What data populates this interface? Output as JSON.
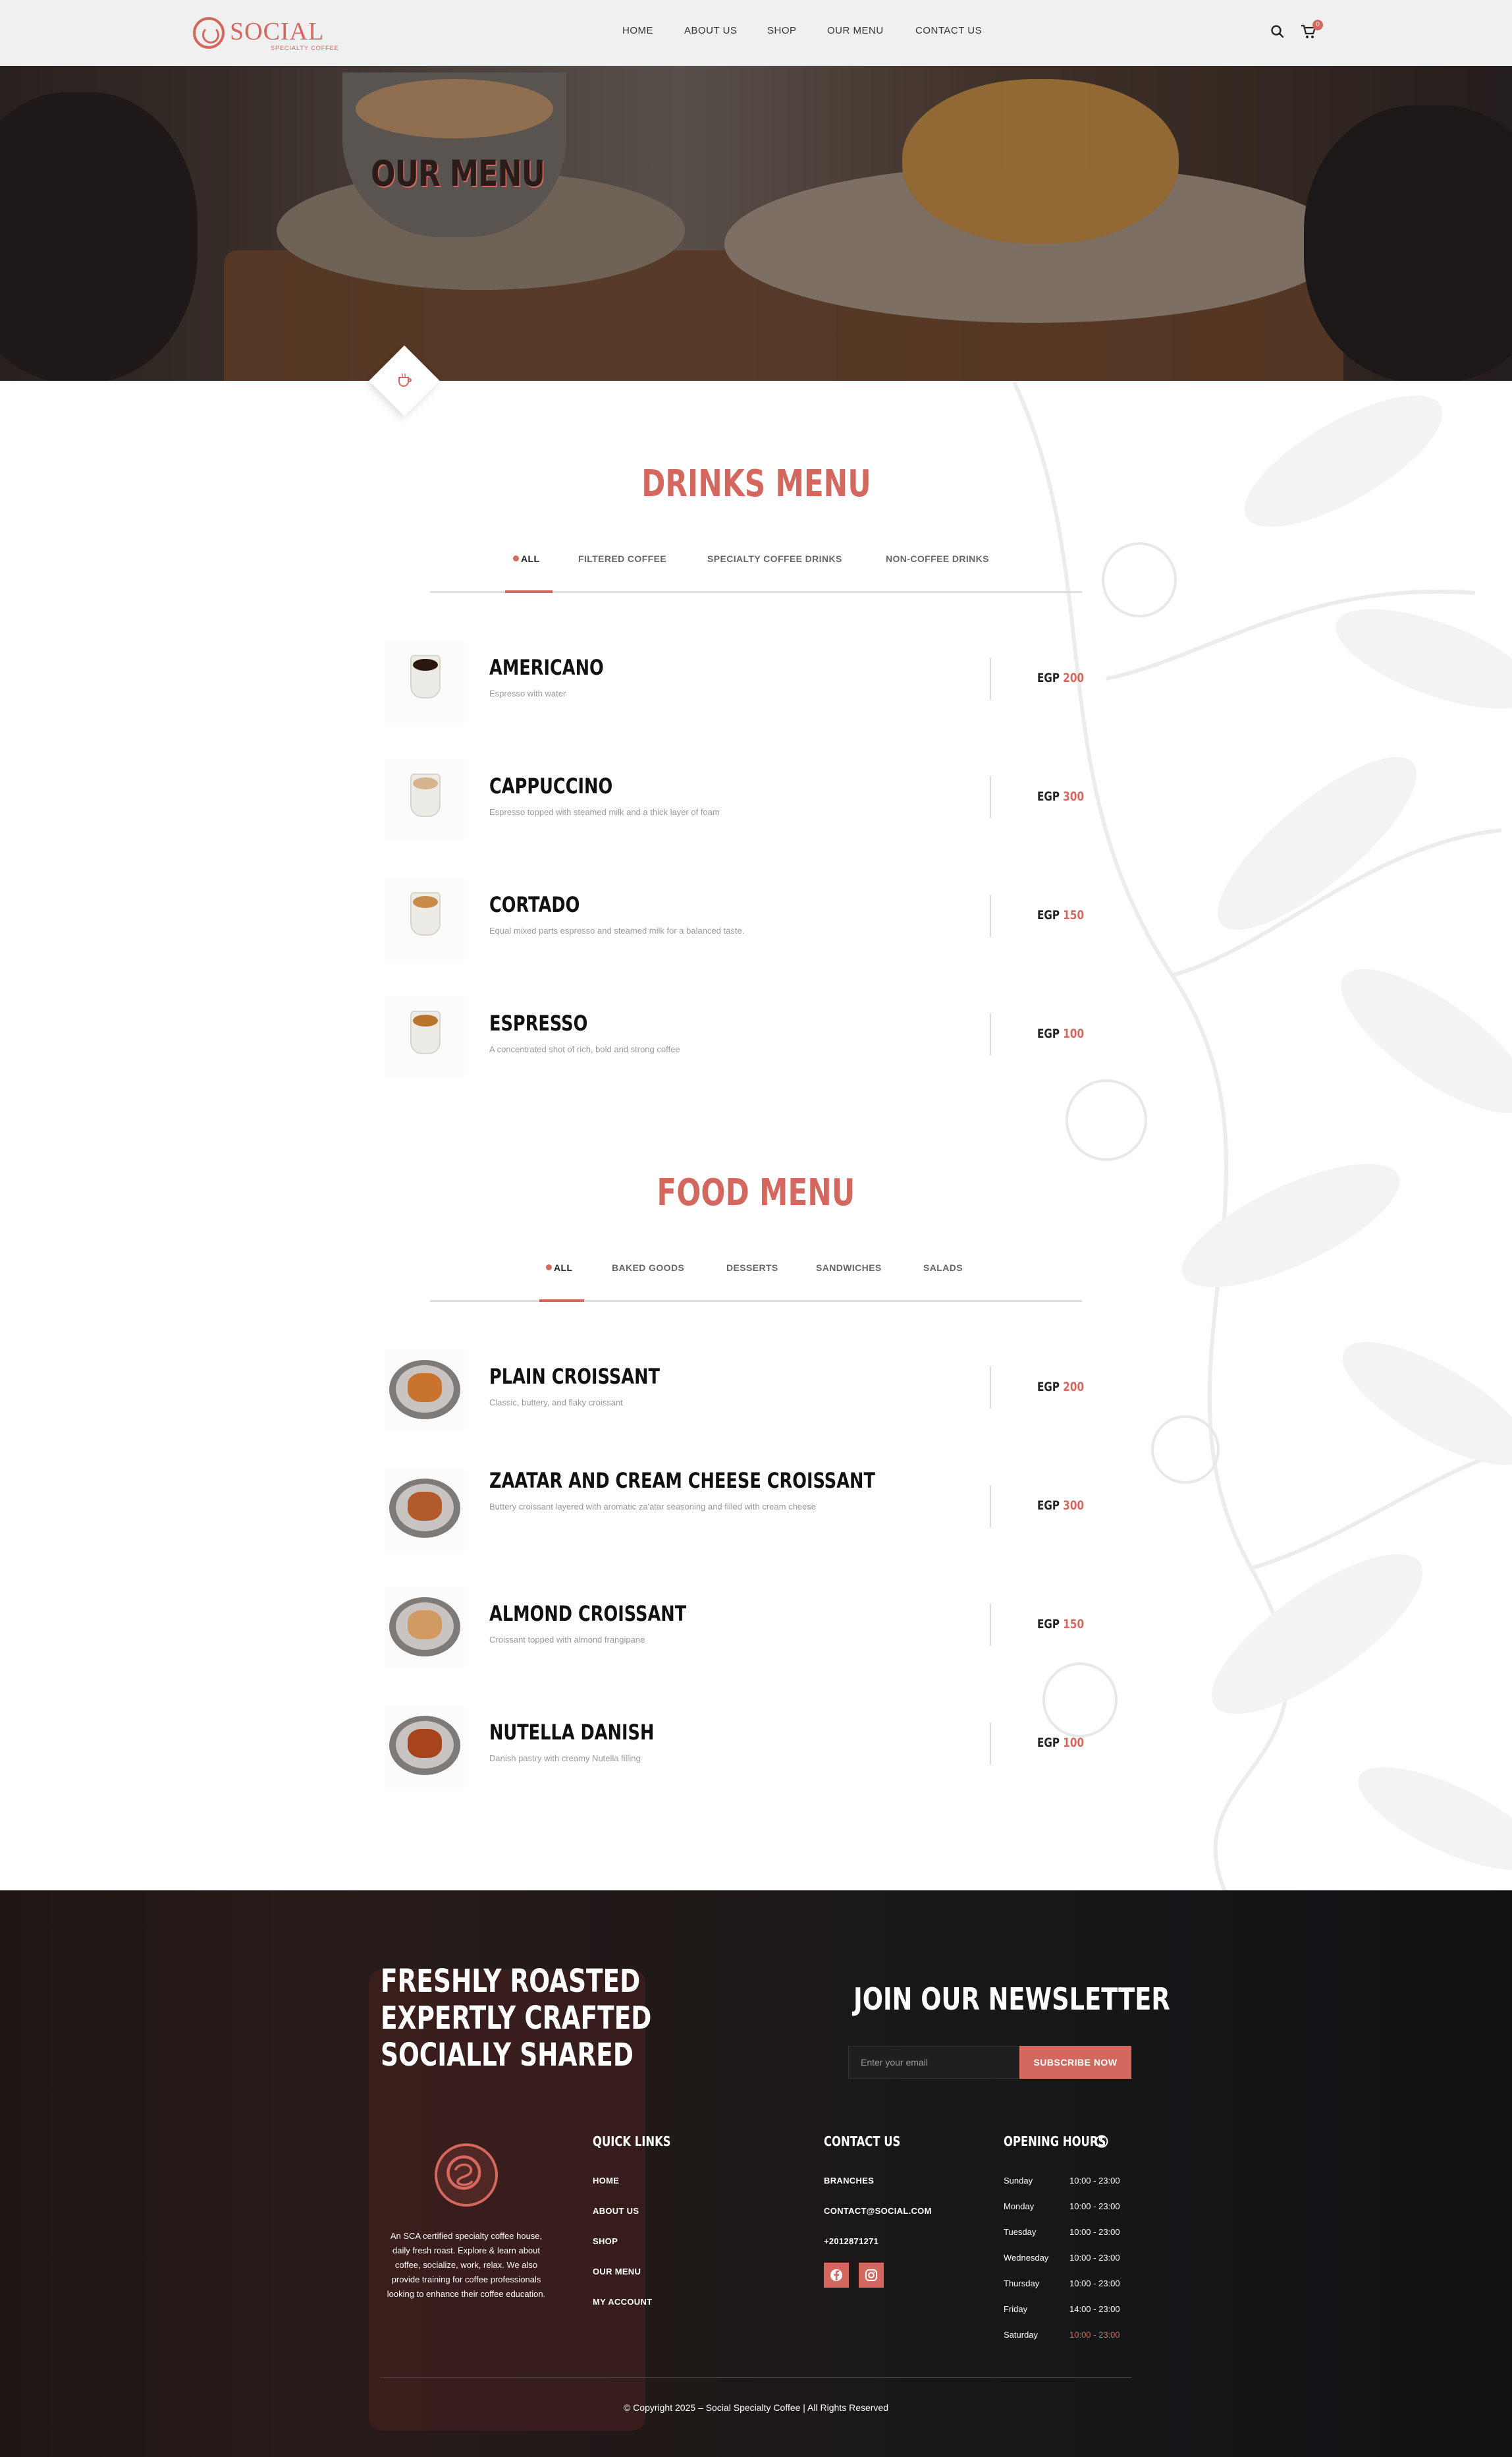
{
  "brand": {
    "name": "SOCIAL",
    "tagline": "SPECIALTY COFFEE",
    "accent_color": "#d5685e"
  },
  "nav": {
    "items": [
      "HOME",
      "ABOUT US",
      "SHOP",
      "OUR MENU",
      "CONTACT US"
    ],
    "search_icon": "search-icon",
    "cart_icon": "cart-icon",
    "cart_count": "0"
  },
  "hero": {
    "title": "OUR MENU"
  },
  "drinks": {
    "title": "DRINKS MENU",
    "tabs": [
      "ALL",
      "FILTERED COFFEE",
      "SPECIALTY COFFEE DRINKS",
      "NON-COFFEE DRINKS"
    ],
    "active_tab": "ALL",
    "items": [
      {
        "name": "AMERICANO",
        "desc": "Espresso with water",
        "currency": "EGP",
        "price": "200"
      },
      {
        "name": "CAPPUCCINO",
        "desc": "Espresso topped with steamed milk and a thick layer of foam",
        "currency": "EGP",
        "price": "300"
      },
      {
        "name": "CORTADO",
        "desc": "Equal mixed parts espresso and steamed milk for a balanced taste.",
        "currency": "EGP",
        "price": "150"
      },
      {
        "name": "ESPRESSO",
        "desc": "A concentrated shot of rich, bold and strong coffee",
        "currency": "EGP",
        "price": "100"
      }
    ]
  },
  "food": {
    "title": "FOOD MENU",
    "tabs": [
      "ALL",
      "BAKED GOODS",
      "DESSERTS",
      "SANDWICHES",
      "SALADS"
    ],
    "active_tab": "ALL",
    "items": [
      {
        "name": "PLAIN CROISSANT",
        "desc": "Classic, buttery, and flaky croissant",
        "currency": "EGP",
        "price": "200"
      },
      {
        "name": "ZAATAR AND CREAM CHEESE CROISSANT",
        "desc": "Buttery croissant layered with aromatic za'atar seasoning and filled with cream cheese",
        "currency": "EGP",
        "price": "300"
      },
      {
        "name": "ALMOND CROISSANT",
        "desc": "Croissant topped with almond frangipane",
        "currency": "EGP",
        "price": "150"
      },
      {
        "name": "NUTELLA DANISH",
        "desc": "Danish pastry with creamy Nutella filling",
        "currency": "EGP",
        "price": "100"
      }
    ]
  },
  "footer": {
    "tagline": [
      "FRESHLY ROASTED",
      "EXPERTLY CRAFTED",
      "SOCIALLY SHARED"
    ],
    "newsletter": {
      "title": "JOIN OUR NEWSLETTER",
      "placeholder": "Enter your email",
      "button": "SUBSCRIBE NOW"
    },
    "about": "An SCA certified specialty coffee house, daily fresh roast. Explore & learn about coffee, socialize, work, relax. We also provide training for coffee professionals looking to enhance their coffee education.",
    "quick_links": {
      "title": "QUICK LINKS",
      "items": [
        "HOME",
        "ABOUT US",
        "SHOP",
        "OUR MENU",
        "MY ACCOUNT"
      ]
    },
    "contact": {
      "title": "CONTACT US",
      "items": [
        "BRANCHES",
        "CONTACT@SOCIAL.COM",
        "+2012871271"
      ],
      "social_icons": [
        "facebook-icon",
        "instagram-icon"
      ]
    },
    "hours": {
      "title": "OPENING HOURS",
      "rows": [
        {
          "day": "Sunday",
          "time": "10:00 - 23:00"
        },
        {
          "day": "Monday",
          "time": "10:00 - 23:00"
        },
        {
          "day": "Tuesday",
          "time": "10:00 - 23:00"
        },
        {
          "day": "Wednesday",
          "time": "10:00 - 23:00"
        },
        {
          "day": "Thursday",
          "time": "10:00 - 23:00"
        },
        {
          "day": "Friday",
          "time": "14:00 - 23:00"
        },
        {
          "day": "Saturday",
          "time": "10:00 - 23:00"
        }
      ]
    },
    "copyright": "© Copyright 2025 – Social Specialty Coffee | All Rights Reserved"
  }
}
